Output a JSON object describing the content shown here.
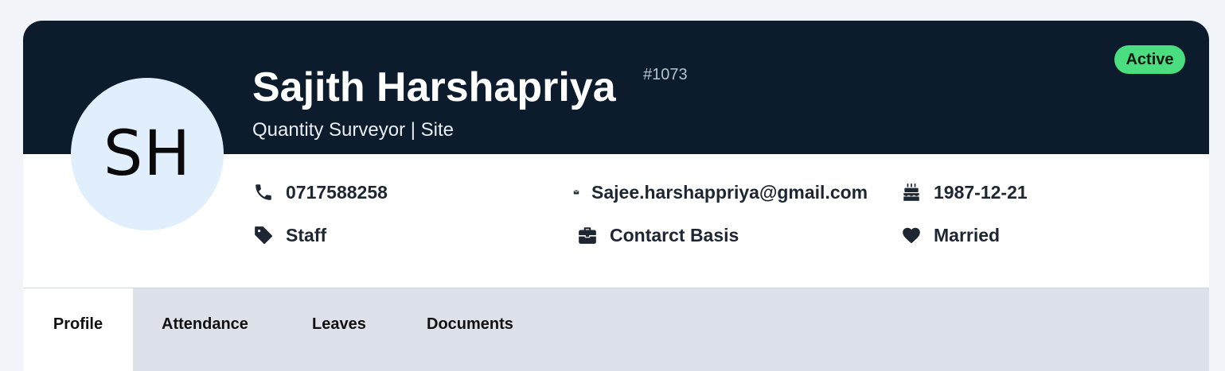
{
  "profile": {
    "initials": "SH",
    "name": "Sajith Harshapriya",
    "employee_id": "#1073",
    "subtitle": "Quantity Surveyor | Site",
    "status": "Active"
  },
  "details": {
    "phone": "0717588258",
    "email": "Sajee.harshappriya@gmail.com",
    "birthday": "1987-12-21",
    "category": "Staff",
    "contract": "Contarct Basis",
    "marital_status": "Married"
  },
  "tabs": [
    {
      "label": "Profile",
      "active": true
    },
    {
      "label": "Attendance",
      "active": false
    },
    {
      "label": "Leaves",
      "active": false
    },
    {
      "label": "Documents",
      "active": false
    }
  ],
  "colors": {
    "banner": "#0c1c2c",
    "status": "#4ade80",
    "avatar": "#e1effd",
    "tab_bar": "#dde1e9"
  },
  "icons": {
    "phone": "phone-icon",
    "email": "envelope-icon",
    "birthday": "birthday-cake-icon",
    "category": "tag-icon",
    "contract": "briefcase-icon",
    "marital_status": "heart-icon"
  }
}
